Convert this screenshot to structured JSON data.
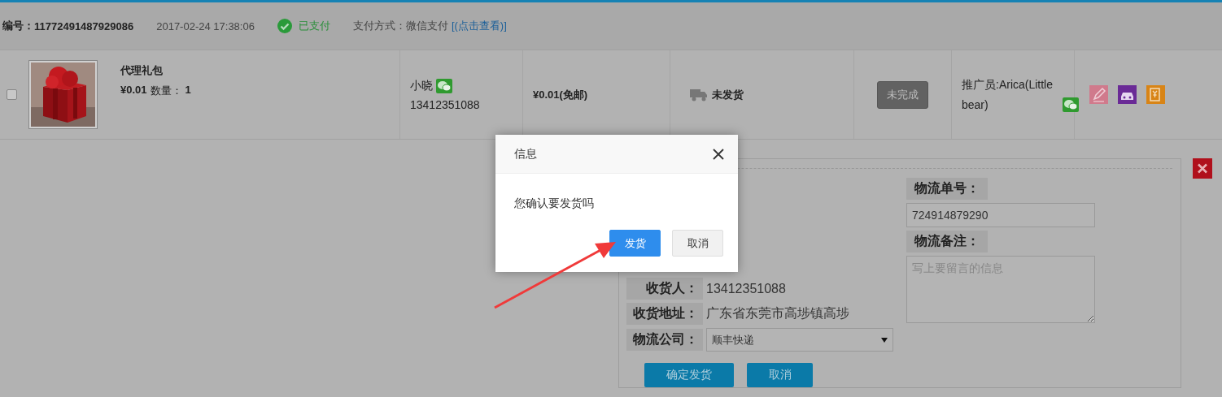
{
  "header": {
    "order_label": "编号：",
    "order_no": "11772491487929086",
    "datetime": "2017-02-24 17:38:06",
    "pay_status": "已支付",
    "pay_method": "支付方式：微信支付",
    "view_link": "[(点击查看)]"
  },
  "order_row": {
    "selected": false,
    "product": {
      "name": "代理礼包",
      "price": "¥0.01",
      "qty_label": "数量：",
      "qty": "1"
    },
    "buyer": {
      "name": "小晓",
      "phone": "13412351088"
    },
    "total": "¥0.01(免邮)",
    "shipping_status": "未发货",
    "completion": "未完成",
    "promoter": "推广员:Arica(Little bear)",
    "actions": [
      {
        "kind": "edit"
      },
      {
        "kind": "car"
      },
      {
        "kind": "invoice"
      }
    ]
  },
  "shipping_form": {
    "fields": [
      {
        "label": "收货人：",
        "value": "13412351088",
        "kind": "text"
      },
      {
        "label": "收货地址：",
        "value": "广东省东莞市高埗镇高埗",
        "kind": "text"
      },
      {
        "label": "物流公司：",
        "value": "顺丰快递",
        "kind": "select"
      }
    ],
    "tracking": {
      "label": "物流单号：",
      "value": "724914879290"
    },
    "note": {
      "label": "物流备注：",
      "placeholder": "写上要留言的信息"
    },
    "buttons": [
      "确定发货",
      "取消"
    ]
  },
  "dialog": {
    "title": "信息",
    "message": "您确认要发货吗",
    "buttons": [
      {
        "label": "发货",
        "primary": true
      },
      {
        "label": "取消",
        "primary": false
      }
    ]
  }
}
